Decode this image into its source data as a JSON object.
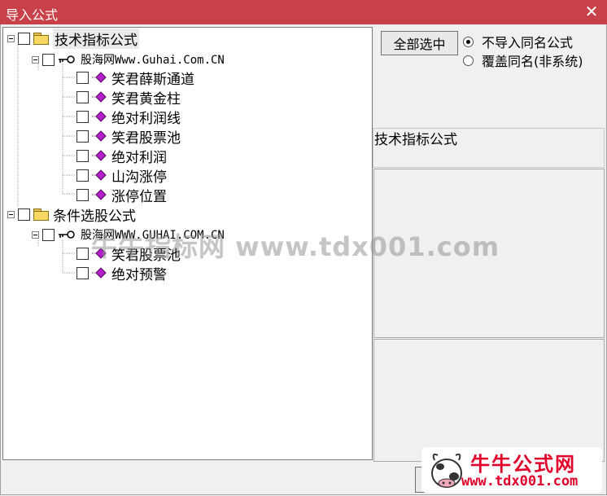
{
  "window": {
    "title": "导入公式",
    "close_glyph": "✕"
  },
  "tree": {
    "groups": [
      {
        "label": "技术指标公式",
        "author": "股海网Www.Guhai.Com.CN",
        "items": [
          "笑君薛斯通道",
          "笑君黄金柱",
          "绝对利润线",
          "笑君股票池",
          "绝对利润",
          "山沟涨停",
          "涨停位置"
        ]
      },
      {
        "label": "条件选股公式",
        "author": "股海网WWW.GUHAI.COM.CN",
        "items": [
          "笑君股票池",
          "绝对预警"
        ]
      }
    ]
  },
  "options": {
    "select_all_label": "全部选中",
    "radio_skip_label": "不导入同名公式",
    "radio_overwrite_label": "覆盖同名(非系统)",
    "selected": "skip"
  },
  "info": {
    "title": "技术指标公式"
  },
  "watermarks": {
    "center": "牛牛指标网 www.tdx001.com",
    "brand": "牛牛公式网",
    "url": "www.tdx001.com"
  },
  "colors": {
    "titlebar": "#c84048",
    "watermark_red": "#e0002a"
  }
}
